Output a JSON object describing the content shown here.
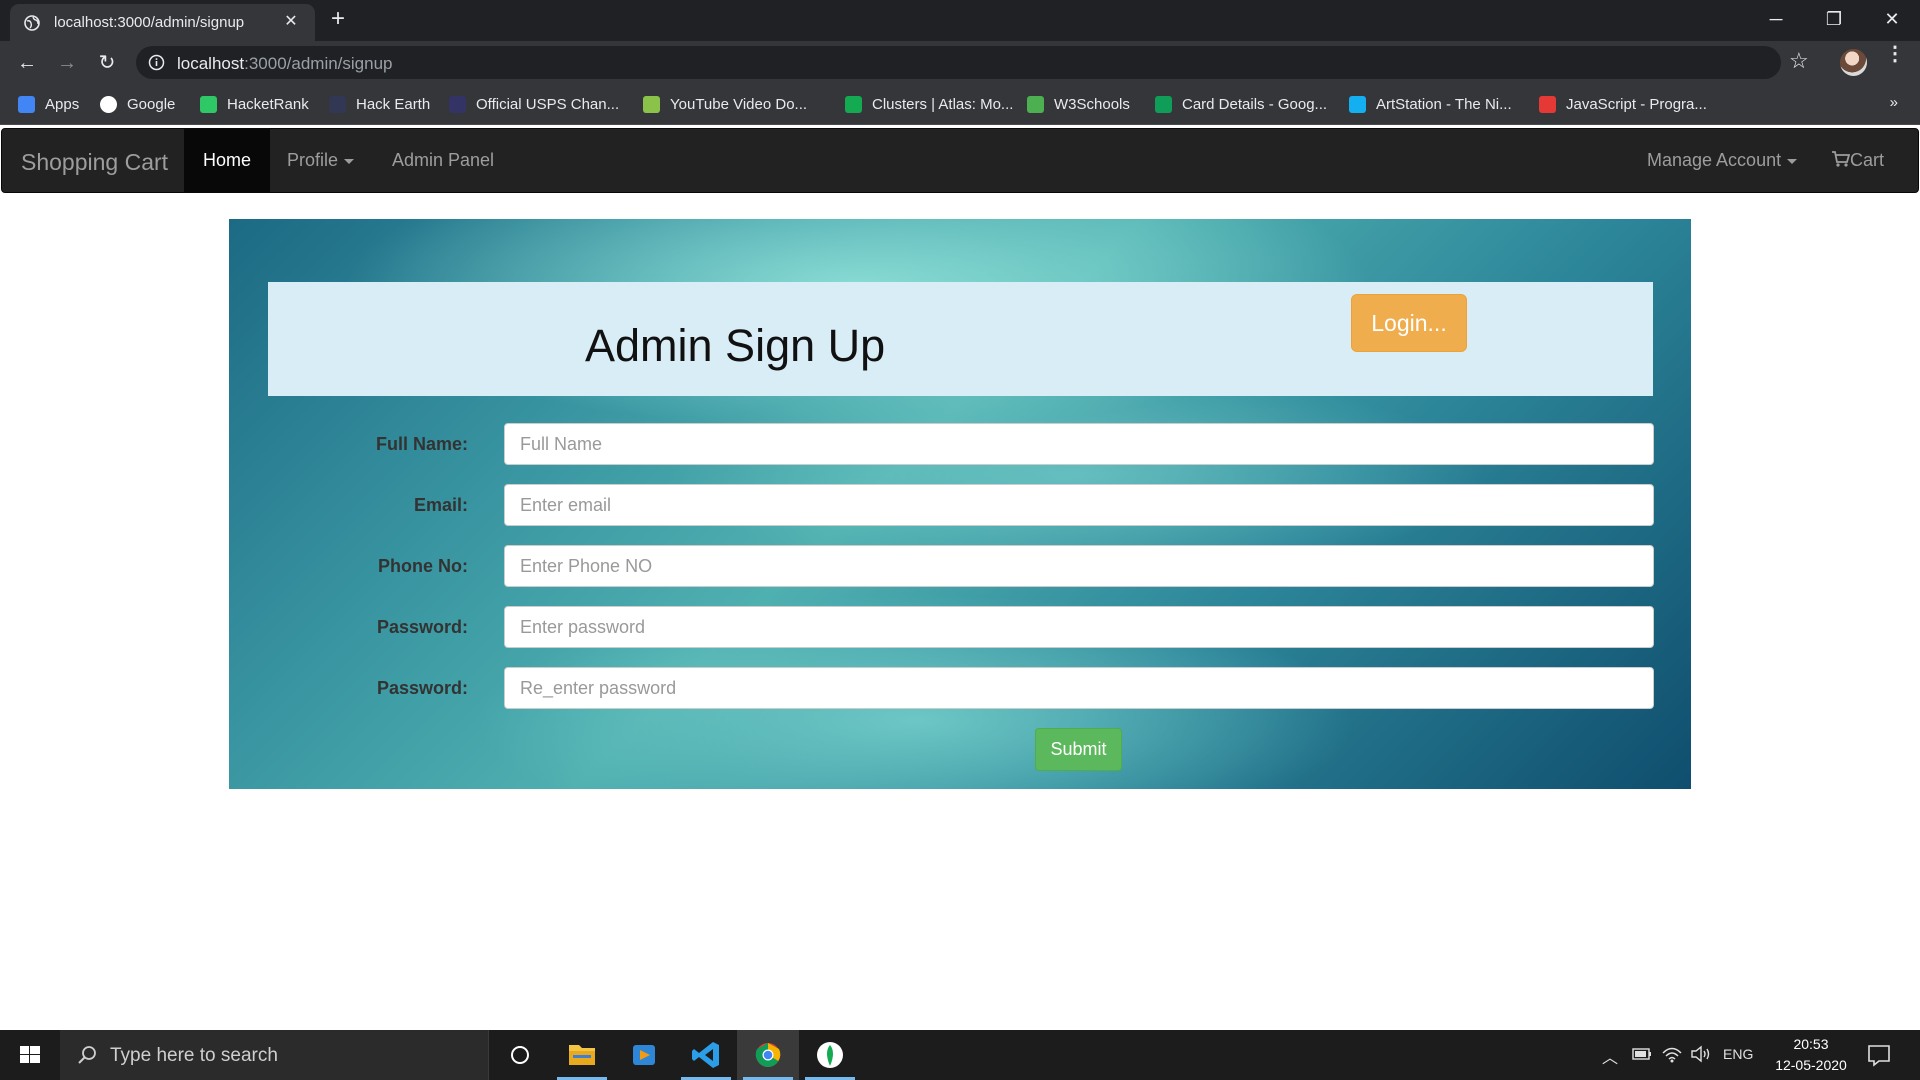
{
  "browser": {
    "tab_title": "localhost:3000/admin/signup",
    "tab_close": "✕",
    "new_tab": "+",
    "window_controls": {
      "minimize": "─",
      "restore": "❐",
      "close": "✕"
    },
    "nav": {
      "back": "←",
      "forward": "→",
      "reload": "↻"
    },
    "url_host": "localhost",
    "url_path": ":3000/admin/signup",
    "star": "☆",
    "menu": "⋮",
    "bookmarks": [
      {
        "label": "Apps",
        "icon": "apps-grid-icon",
        "color": "#4285f4"
      },
      {
        "label": "Google",
        "icon": "google-icon",
        "color": "#ffffff"
      },
      {
        "label": "HacketRank",
        "icon": "hackerrank-icon",
        "color": "#2ec866"
      },
      {
        "label": "Hack Earth",
        "icon": "hackerearth-icon",
        "color": "#323754"
      },
      {
        "label": "Official USPS Chan...",
        "icon": "usps-icon",
        "color": "#333366"
      },
      {
        "label": "YouTube Video Do...",
        "icon": "download-arrow-icon",
        "color": "#8bc34a"
      },
      {
        "label": "Clusters | Atlas: Mo...",
        "icon": "mongodb-leaf-icon",
        "color": "#13aa52"
      },
      {
        "label": "W3Schools",
        "icon": "w3schools-icon",
        "color": "#4caf50"
      },
      {
        "label": "Card Details - Goog...",
        "icon": "google-sheets-icon",
        "color": "#0f9d58"
      },
      {
        "label": "ArtStation - The Ni...",
        "icon": "artstation-icon",
        "color": "#13aff0"
      },
      {
        "label": "JavaScript - Progra...",
        "icon": "javascript-icon",
        "color": "#e53935"
      }
    ],
    "bookmarks_more": "»"
  },
  "appnav": {
    "brand": "Shopping Cart",
    "home": "Home",
    "profile": "Profile",
    "admin_panel": "Admin Panel",
    "manage_account": "Manage Account",
    "cart": "Cart"
  },
  "signup": {
    "title": "Admin Sign Up",
    "login_button": "Login...",
    "fields": [
      {
        "label": "Full Name:",
        "placeholder": "Full Name"
      },
      {
        "label": "Email:",
        "placeholder": "Enter email"
      },
      {
        "label": "Phone No:",
        "placeholder": "Enter Phone NO"
      },
      {
        "label": "Password:",
        "placeholder": "Enter password"
      },
      {
        "label": "Password:",
        "placeholder": "Re_enter password"
      }
    ],
    "submit": "Submit"
  },
  "taskbar": {
    "search_placeholder": "Type here to search",
    "language": "ENG",
    "time": "20:53",
    "date": "12-05-2020"
  }
}
